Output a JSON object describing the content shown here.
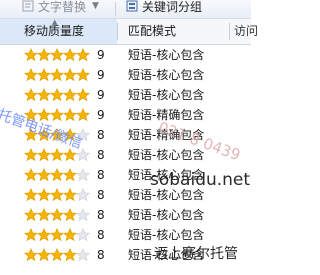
{
  "toolbar": {
    "left_button_label": "文字替换",
    "left_button_icon": "text-replace-icon",
    "right_button_label": "关键词分组",
    "right_button_icon": "keyword-group-icon"
  },
  "table": {
    "columns": [
      "移动质量度",
      "匹配模式",
      "访问"
    ],
    "sorted_column": "移动质量度",
    "star_color": "#f5b400",
    "rows": [
      {
        "stars": 5,
        "score": "9",
        "mode": "短语-核心包含"
      },
      {
        "stars": 5,
        "score": "9",
        "mode": "短语-核心包含"
      },
      {
        "stars": 5,
        "score": "9",
        "mode": "短语-核心包含"
      },
      {
        "stars": 5,
        "score": "9",
        "mode": "短语-精确包含"
      },
      {
        "stars": 4,
        "score": "8",
        "mode": "短语-精确包含"
      },
      {
        "stars": 4,
        "score": "8",
        "mode": "短语-核心包含"
      },
      {
        "stars": 4,
        "score": "8",
        "mode": "短语-核心包含"
      },
      {
        "stars": 4,
        "score": "8",
        "mode": "短语-核心包含"
      },
      {
        "stars": 4,
        "score": "8",
        "mode": "短语-核心包含"
      },
      {
        "stars": 4,
        "score": "8",
        "mode": "短语-核心包含"
      },
      {
        "stars": 4,
        "score": "8",
        "mode": "短语-核心包含"
      }
    ]
  },
  "watermark": {
    "left": "托管电话/微信",
    "phone": "021 8 0439",
    "site": "sobaidu.net",
    "corner": "迈上赛尔托管"
  }
}
